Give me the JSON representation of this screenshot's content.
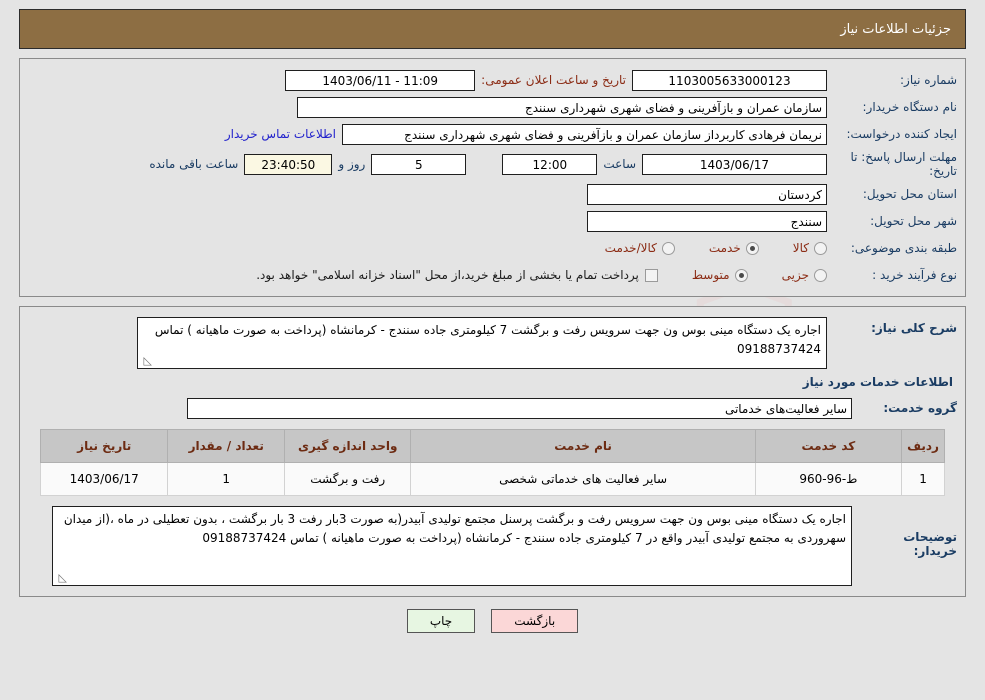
{
  "header": {
    "title": "جزئیات اطلاعات نیاز"
  },
  "info": {
    "need_number_label": "شماره نیاز:",
    "need_number_value": "1103005633000123",
    "announce_label": "تاریخ و ساعت اعلان عمومی:",
    "announce_value": "1403/06/11 - 11:09",
    "buyer_org_label": "نام دستگاه خریدار:",
    "buyer_org_value": "سازمان عمران و بازآفرینی و فضای شهری شهرداری سنندج",
    "creator_label": "ایجاد کننده درخواست:",
    "creator_value": "نریمان فرهادی کاربرداز سازمان عمران و بازآفرینی و فضای شهری شهرداری سنندج",
    "contact_link": "اطلاعات تماس خریدار",
    "deadline_label": "مهلت ارسال پاسخ: تا تاریخ:",
    "deadline_date": "1403/06/17",
    "deadline_time_label": "ساعت",
    "deadline_time": "12:00",
    "remaining_days": "5",
    "days_and_label": "روز و",
    "remaining_time": "23:40:50",
    "remaining_suffix": "ساعت باقی مانده",
    "province_label": "استان محل تحویل:",
    "province_value": "کردستان",
    "city_label": "شهر محل تحویل:",
    "city_value": "سنندج",
    "category_label": "طبقه بندی موضوعی:",
    "category_options": [
      {
        "label": "کالا",
        "checked": false
      },
      {
        "label": "خدمت",
        "checked": true
      },
      {
        "label": "کالا/خدمت",
        "checked": false
      }
    ],
    "process_label": "نوع فرآیند خرید :",
    "process_options": [
      {
        "label": "جزیی",
        "checked": false
      },
      {
        "label": "متوسط",
        "checked": true
      }
    ],
    "treasury_checkbox_checked": false,
    "treasury_note": "پرداخت تمام یا بخشی از مبلغ خرید،از محل \"اسناد خزانه اسلامی\" خواهد بود."
  },
  "detail": {
    "need_desc_label": "شرح کلی نیاز:",
    "need_desc_value": "اجاره یک دستگاه مینی بوس ون جهت سرویس رفت و برگشت  7 کیلومتری جاده سنندج - کرمانشاه (پرداخت به صورت ماهیانه ) تماس 09188737424",
    "services_section_title": "اطلاعات خدمات مورد نیاز",
    "service_group_label": "گروه خدمت:",
    "service_group_value": "سایر فعالیت‌های خدماتی",
    "table": {
      "headers": [
        "ردیف",
        "کد خدمت",
        "نام خدمت",
        "واحد اندازه گیری",
        "تعداد / مقدار",
        "تاریخ نیاز"
      ],
      "rows": [
        {
          "radif": "1",
          "code": "ط-96-960",
          "name": "سایر فعالیت های خدماتی شخصی",
          "unit": "رفت و برگشت",
          "qty": "1",
          "date": "1403/06/17"
        }
      ]
    },
    "buyer_notes_label": "توضیحات خریدار:",
    "buyer_notes_value": "اجاره یک دستگاه مینی بوس ون جهت سرویس رفت و برگشت پرسنل مجتمع تولیدی آبیدر(به صورت 3بار رفت 3 بار برگشت ، بدون تعطیلی در ماه ،(از میدان سهروردی به مجتمع تولیدی آبیدر واقع در 7 کیلومتری جاده سنندج - کرمانشاه (پرداخت به صورت ماهیانه ) تماس 09188737424"
  },
  "footer": {
    "print_label": "چاپ",
    "back_label": "بازگشت"
  },
  "watermark": {
    "text": "AriaTender.net"
  },
  "colors": {
    "banner": "#8d6e43",
    "label_blue": "#1a3c63",
    "accent_red": "#8b2b14",
    "link_blue": "#2222cc",
    "table_header": "#c6c6c6",
    "countdown_bg": "#fbf8e3"
  }
}
